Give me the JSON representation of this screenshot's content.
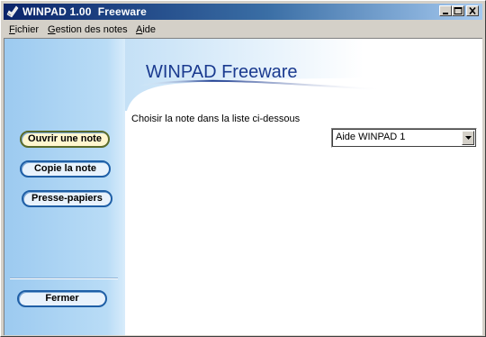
{
  "window": {
    "title": "WINPAD 1.00  Freeware",
    "controls": [
      "minimize-icon",
      "maximize-icon",
      "close-icon"
    ]
  },
  "menu": {
    "items": [
      {
        "label": "Fichier"
      },
      {
        "label": "Gestion des notes"
      },
      {
        "label": "Aide"
      }
    ]
  },
  "header": {
    "title": "WINPAD Freeware"
  },
  "sidebar": {
    "buttons": [
      {
        "label": "Ouvrir une note"
      },
      {
        "label": "Copie la note"
      },
      {
        "label": "Presse-papiers"
      }
    ],
    "close_label": "Fermer"
  },
  "main": {
    "prompt": "Choisir la note dans la liste ci-dessous",
    "note_select": {
      "value": "Aide WINPAD 1"
    }
  },
  "colors": {
    "title_bar_start": "#0a246a",
    "title_bar_end": "#a6caf0",
    "sidebar_blue": "#a9d2f2",
    "header_text": "#1a3a8f"
  }
}
